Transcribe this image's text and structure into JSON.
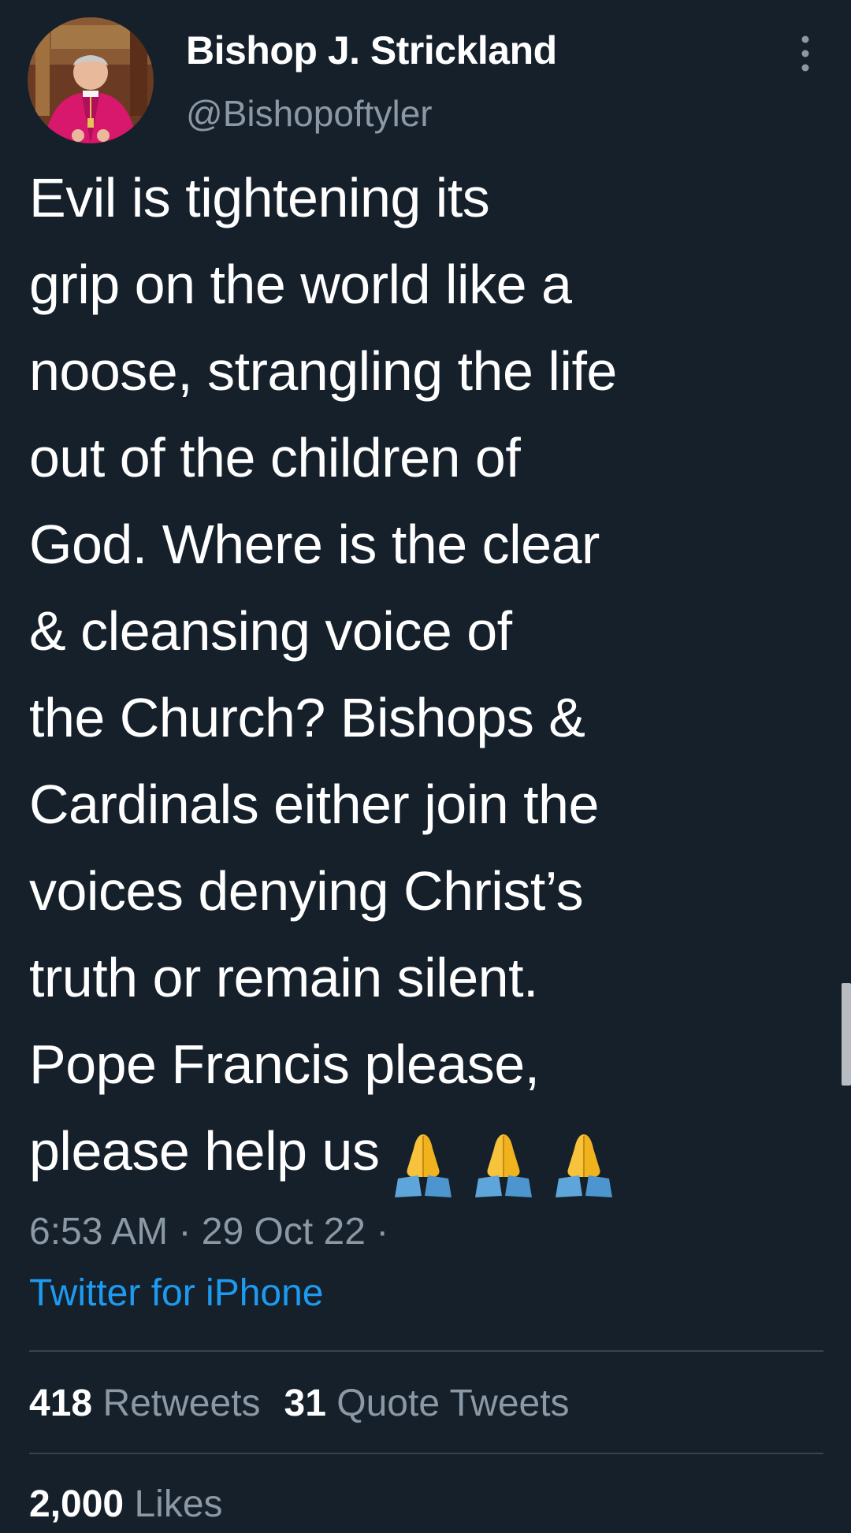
{
  "tweet": {
    "author": {
      "display_name": "Bishop J. Strickland",
      "handle": "@Bishopoftyler"
    },
    "text": "Evil is tightening its\ngrip on the world like a\nnoose, strangling the life\nout of the children of\nGod. Where is the clear\n& cleansing voice of\nthe Church? Bishops &\nCardinals either join the\nvoices denying Christ’s\ntruth or remain silent.\nPope Francis please,\nplease help us",
    "emoji_icons": [
      "folded-hands-icon",
      "folded-hands-icon",
      "folded-hands-icon"
    ],
    "timestamp": "6:53 AM · 29 Oct 22 ·",
    "source": "Twitter for iPhone"
  },
  "stats": {
    "retweets": {
      "count": "418",
      "label": "Retweets"
    },
    "quote_tweets": {
      "count": "31",
      "label": "Quote Tweets"
    },
    "likes": {
      "count": "2,000",
      "label": "Likes"
    }
  },
  "theme": {
    "background": "#15202b",
    "text": "#ffffff",
    "secondary_text": "#8b98a5",
    "link": "#1d9bf0",
    "divider": "#38444d",
    "emoji_skin": "#f7c23c",
    "emoji_sleeve": "#5ea5dc"
  }
}
